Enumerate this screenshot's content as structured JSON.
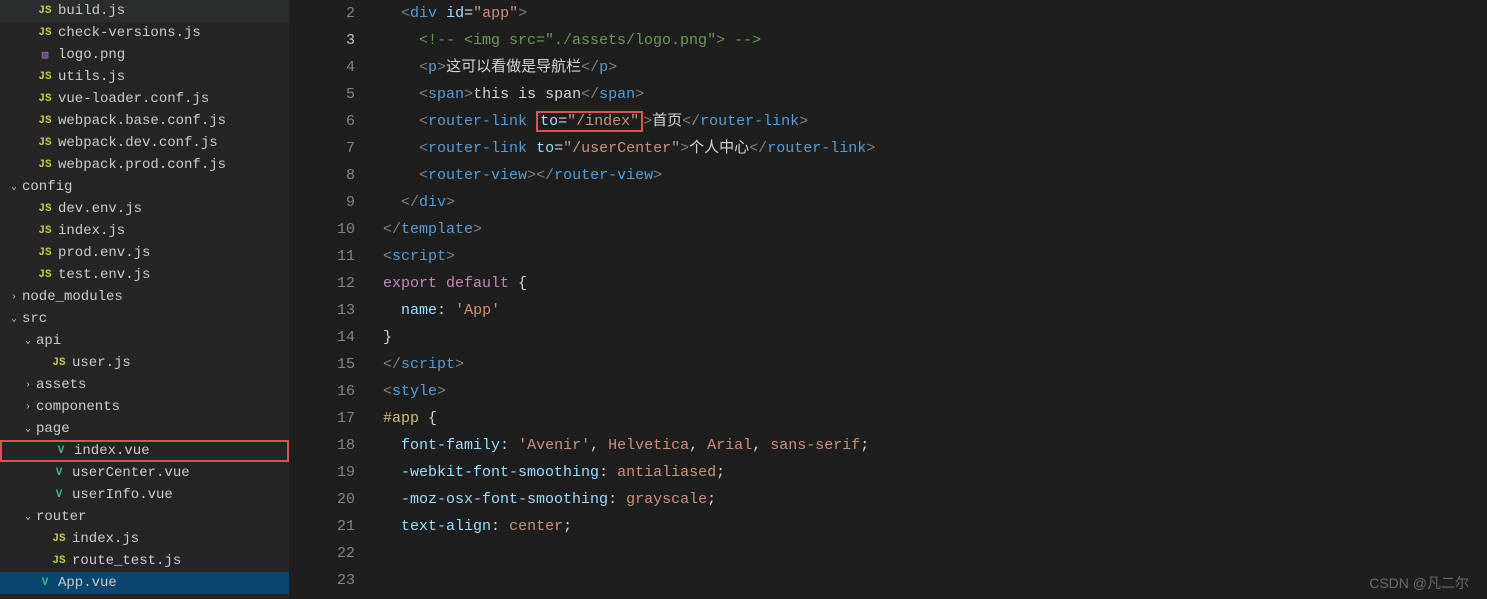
{
  "watermark": "CSDN @凡二尔",
  "sidebar": {
    "items": [
      {
        "name": "build.js",
        "type": "js",
        "indent": 14
      },
      {
        "name": "check-versions.js",
        "type": "js",
        "indent": 14
      },
      {
        "name": "logo.png",
        "type": "img",
        "indent": 14
      },
      {
        "name": "utils.js",
        "type": "js",
        "indent": 14
      },
      {
        "name": "vue-loader.conf.js",
        "type": "js",
        "indent": 14
      },
      {
        "name": "webpack.base.conf.js",
        "type": "js",
        "indent": 14
      },
      {
        "name": "webpack.dev.conf.js",
        "type": "js",
        "indent": 14
      },
      {
        "name": "webpack.prod.conf.js",
        "type": "js",
        "indent": 14
      },
      {
        "name": "config",
        "type": "folder-open",
        "indent": 0
      },
      {
        "name": "dev.env.js",
        "type": "js",
        "indent": 14
      },
      {
        "name": "index.js",
        "type": "js",
        "indent": 14
      },
      {
        "name": "prod.env.js",
        "type": "js",
        "indent": 14
      },
      {
        "name": "test.env.js",
        "type": "js",
        "indent": 14
      },
      {
        "name": "node_modules",
        "type": "folder-closed",
        "indent": 0
      },
      {
        "name": "src",
        "type": "folder-open",
        "indent": 0
      },
      {
        "name": "api",
        "type": "folder-open",
        "indent": 14
      },
      {
        "name": "user.js",
        "type": "js",
        "indent": 28
      },
      {
        "name": "assets",
        "type": "folder-closed",
        "indent": 14
      },
      {
        "name": "components",
        "type": "folder-closed",
        "indent": 14
      },
      {
        "name": "page",
        "type": "folder-open",
        "indent": 14
      },
      {
        "name": "index.vue",
        "type": "vue",
        "indent": 28,
        "hl": true
      },
      {
        "name": "userCenter.vue",
        "type": "vue",
        "indent": 28
      },
      {
        "name": "userInfo.vue",
        "type": "vue",
        "indent": 28
      },
      {
        "name": "router",
        "type": "folder-open",
        "indent": 14
      },
      {
        "name": "index.js",
        "type": "js",
        "indent": 28
      },
      {
        "name": "route_test.js",
        "type": "js",
        "indent": 28
      },
      {
        "name": "App.vue",
        "type": "vue",
        "indent": 14,
        "active": true
      }
    ]
  },
  "icons": {
    "js": "JS",
    "img": "▧",
    "vue": "V",
    "chev_open": "⌄",
    "chev_closed": "›"
  },
  "editor": {
    "currentLine": 3,
    "lines": [
      {
        "n": 2,
        "seg": [
          {
            "t": "  ",
            "c": "text"
          },
          {
            "t": "<",
            "c": "bracket"
          },
          {
            "t": "div",
            "c": "tag"
          },
          {
            "t": " ",
            "c": "text"
          },
          {
            "t": "id",
            "c": "attr"
          },
          {
            "t": "=",
            "c": "punc"
          },
          {
            "t": "\"app\"",
            "c": "str"
          },
          {
            "t": ">",
            "c": "bracket"
          }
        ]
      },
      {
        "n": 3,
        "seg": [
          {
            "t": "    ",
            "c": "text"
          },
          {
            "t": "<!-- <img src=\"./assets/logo.png\"> -->",
            "c": "comment"
          }
        ]
      },
      {
        "n": 4,
        "seg": [
          {
            "t": "    ",
            "c": "text"
          },
          {
            "t": "<",
            "c": "bracket"
          },
          {
            "t": "p",
            "c": "tag"
          },
          {
            "t": ">",
            "c": "bracket"
          },
          {
            "t": "这可以看做是导航栏",
            "c": "text"
          },
          {
            "t": "</",
            "c": "bracket"
          },
          {
            "t": "p",
            "c": "tag"
          },
          {
            "t": ">",
            "c": "bracket"
          }
        ]
      },
      {
        "n": 5,
        "seg": [
          {
            "t": "    ",
            "c": "text"
          },
          {
            "t": "<",
            "c": "bracket"
          },
          {
            "t": "span",
            "c": "tag"
          },
          {
            "t": ">",
            "c": "bracket"
          },
          {
            "t": "this is span",
            "c": "text"
          },
          {
            "t": "</",
            "c": "bracket"
          },
          {
            "t": "span",
            "c": "tag"
          },
          {
            "t": ">",
            "c": "bracket"
          }
        ]
      },
      {
        "n": 6,
        "seg": [
          {
            "t": "    ",
            "c": "text"
          },
          {
            "t": "<",
            "c": "bracket"
          },
          {
            "t": "router-link",
            "c": "tag"
          },
          {
            "t": " ",
            "c": "text"
          },
          {
            "t": "to",
            "c": "attr",
            "box": true
          },
          {
            "t": "=",
            "c": "punc",
            "box": true
          },
          {
            "t": "\"/index\"",
            "c": "str",
            "box": true
          },
          {
            "t": ">",
            "c": "bracket"
          },
          {
            "t": "首页",
            "c": "text"
          },
          {
            "t": "</",
            "c": "bracket"
          },
          {
            "t": "router-link",
            "c": "tag"
          },
          {
            "t": ">",
            "c": "bracket"
          }
        ]
      },
      {
        "n": 7,
        "seg": [
          {
            "t": "    ",
            "c": "text"
          },
          {
            "t": "<",
            "c": "bracket"
          },
          {
            "t": "router-link",
            "c": "tag"
          },
          {
            "t": " ",
            "c": "text"
          },
          {
            "t": "to",
            "c": "attr"
          },
          {
            "t": "=",
            "c": "punc"
          },
          {
            "t": "\"/userCenter\"",
            "c": "str"
          },
          {
            "t": ">",
            "c": "bracket"
          },
          {
            "t": "个人中心",
            "c": "text"
          },
          {
            "t": "</",
            "c": "bracket"
          },
          {
            "t": "router-link",
            "c": "tag"
          },
          {
            "t": ">",
            "c": "bracket"
          }
        ]
      },
      {
        "n": 8,
        "seg": [
          {
            "t": "    ",
            "c": "text"
          },
          {
            "t": "<",
            "c": "bracket"
          },
          {
            "t": "router-view",
            "c": "tag"
          },
          {
            "t": ">",
            "c": "bracket"
          },
          {
            "t": "</",
            "c": "bracket"
          },
          {
            "t": "router-view",
            "c": "tag"
          },
          {
            "t": ">",
            "c": "bracket"
          }
        ]
      },
      {
        "n": 9,
        "seg": [
          {
            "t": "  ",
            "c": "text"
          },
          {
            "t": "</",
            "c": "bracket"
          },
          {
            "t": "div",
            "c": "tag"
          },
          {
            "t": ">",
            "c": "bracket"
          }
        ]
      },
      {
        "n": 10,
        "seg": [
          {
            "t": "</",
            "c": "bracket"
          },
          {
            "t": "template",
            "c": "tag"
          },
          {
            "t": ">",
            "c": "bracket"
          }
        ]
      },
      {
        "n": 11,
        "seg": [
          {
            "t": "",
            "c": "text"
          }
        ]
      },
      {
        "n": 12,
        "seg": [
          {
            "t": "<",
            "c": "bracket"
          },
          {
            "t": "script",
            "c": "tag"
          },
          {
            "t": ">",
            "c": "bracket"
          }
        ]
      },
      {
        "n": 13,
        "seg": [
          {
            "t": "export",
            "c": "keyword"
          },
          {
            "t": " ",
            "c": "text"
          },
          {
            "t": "default",
            "c": "keyword"
          },
          {
            "t": " {",
            "c": "punc"
          }
        ]
      },
      {
        "n": 14,
        "seg": [
          {
            "t": "  ",
            "c": "text"
          },
          {
            "t": "name",
            "c": "prop"
          },
          {
            "t": ":",
            "c": "punc"
          },
          {
            "t": " ",
            "c": "text"
          },
          {
            "t": "'App'",
            "c": "str"
          }
        ]
      },
      {
        "n": 15,
        "seg": [
          {
            "t": "}",
            "c": "punc"
          }
        ]
      },
      {
        "n": 16,
        "seg": [
          {
            "t": "</",
            "c": "bracket"
          },
          {
            "t": "script",
            "c": "tag"
          },
          {
            "t": ">",
            "c": "bracket"
          }
        ]
      },
      {
        "n": 17,
        "seg": [
          {
            "t": "",
            "c": "text"
          }
        ]
      },
      {
        "n": 18,
        "seg": [
          {
            "t": "<",
            "c": "bracket"
          },
          {
            "t": "style",
            "c": "tag"
          },
          {
            "t": ">",
            "c": "bracket"
          }
        ]
      },
      {
        "n": 19,
        "seg": [
          {
            "t": "#app",
            "c": "func"
          },
          {
            "t": " {",
            "c": "punc"
          }
        ]
      },
      {
        "n": 20,
        "seg": [
          {
            "t": "  ",
            "c": "text"
          },
          {
            "t": "font-family",
            "c": "prop"
          },
          {
            "t": ":",
            "c": "punc"
          },
          {
            "t": " ",
            "c": "text"
          },
          {
            "t": "'Avenir'",
            "c": "value"
          },
          {
            "t": ",",
            "c": "punc"
          },
          {
            "t": " ",
            "c": "text"
          },
          {
            "t": "Helvetica",
            "c": "value"
          },
          {
            "t": ",",
            "c": "punc"
          },
          {
            "t": " ",
            "c": "text"
          },
          {
            "t": "Arial",
            "c": "value"
          },
          {
            "t": ",",
            "c": "punc"
          },
          {
            "t": " ",
            "c": "text"
          },
          {
            "t": "sans-serif",
            "c": "value"
          },
          {
            "t": ";",
            "c": "punc"
          }
        ]
      },
      {
        "n": 21,
        "seg": [
          {
            "t": "  ",
            "c": "text"
          },
          {
            "t": "-webkit-font-smoothing",
            "c": "prop"
          },
          {
            "t": ":",
            "c": "punc"
          },
          {
            "t": " ",
            "c": "text"
          },
          {
            "t": "antialiased",
            "c": "value"
          },
          {
            "t": ";",
            "c": "punc"
          }
        ]
      },
      {
        "n": 22,
        "seg": [
          {
            "t": "  ",
            "c": "text"
          },
          {
            "t": "-moz-osx-font-smoothing",
            "c": "prop"
          },
          {
            "t": ":",
            "c": "punc"
          },
          {
            "t": " ",
            "c": "text"
          },
          {
            "t": "grayscale",
            "c": "value"
          },
          {
            "t": ";",
            "c": "punc"
          }
        ]
      },
      {
        "n": 23,
        "seg": [
          {
            "t": "  ",
            "c": "text"
          },
          {
            "t": "text-align",
            "c": "prop"
          },
          {
            "t": ":",
            "c": "punc"
          },
          {
            "t": " ",
            "c": "text"
          },
          {
            "t": "center",
            "c": "value"
          },
          {
            "t": ";",
            "c": "punc"
          }
        ]
      }
    ]
  }
}
